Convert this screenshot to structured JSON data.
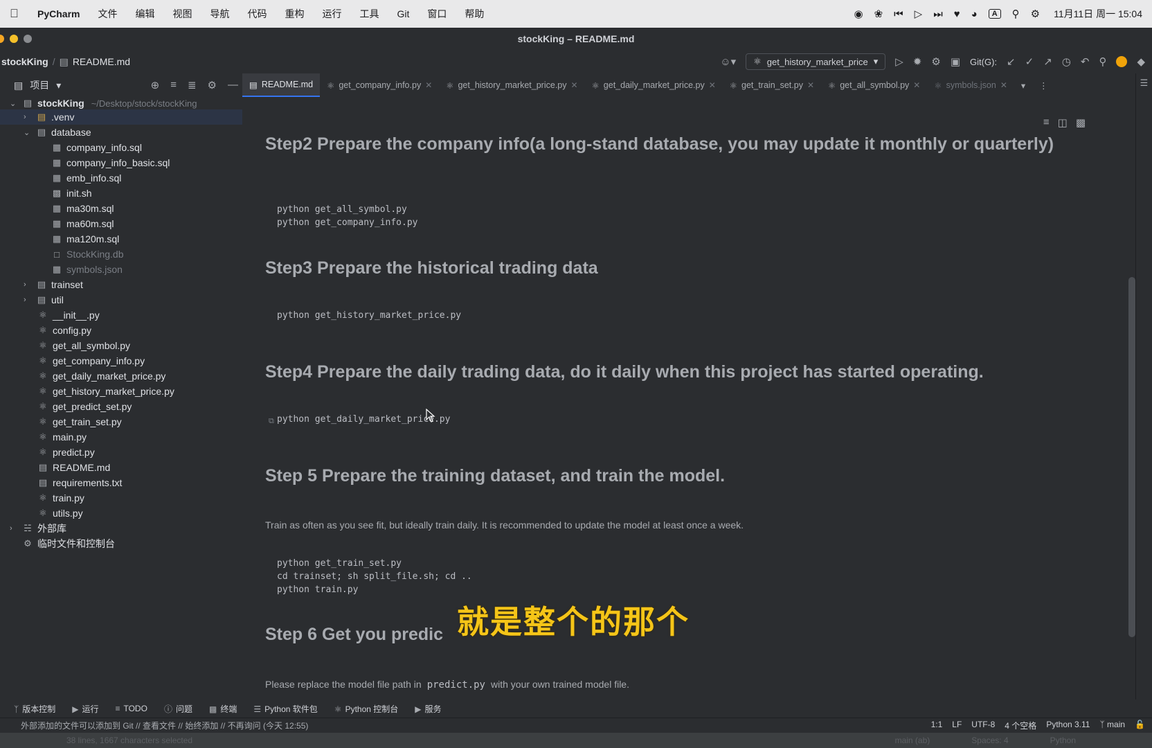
{
  "menubar": {
    "app": "PyCharm",
    "items": [
      "文件",
      "编辑",
      "视图",
      "导航",
      "代码",
      "重构",
      "运行",
      "工具",
      "Git",
      "窗口",
      "帮助"
    ],
    "clock": "11月11日 周一 15:04",
    "input_badge": "A"
  },
  "window": {
    "title": "stockKing – README.md"
  },
  "toolbar": {
    "project": "stockKing",
    "file": "README.md",
    "run_config": "get_history_market_price",
    "git_label": "Git(G):"
  },
  "project_pane": {
    "label": "项目"
  },
  "tabs": [
    {
      "label": "README.md",
      "active": true
    },
    {
      "label": "get_company_info.py"
    },
    {
      "label": "get_history_market_price.py"
    },
    {
      "label": "get_daily_market_price.py"
    },
    {
      "label": "get_train_set.py"
    },
    {
      "label": "get_all_symbol.py"
    },
    {
      "label": "symbols.json"
    }
  ],
  "tree": {
    "root": {
      "label": "stockKing",
      "path": "~/Desktop/stock/stockKing"
    },
    "venv": ".venv",
    "database": "database",
    "db_files": [
      "company_info.sql",
      "company_info_basic.sql",
      "emb_info.sql",
      "init.sh",
      "ma30m.sql",
      "ma60m.sql",
      "ma120m.sql",
      "StockKing.db",
      "symbols.json"
    ],
    "trainset": "trainset",
    "util": "util",
    "root_files": [
      "__init__.py",
      "config.py",
      "get_all_symbol.py",
      "get_company_info.py",
      "get_daily_market_price.py",
      "get_history_market_price.py",
      "get_predict_set.py",
      "get_train_set.py",
      "main.py",
      "predict.py",
      "README.md",
      "requirements.txt",
      "train.py",
      "utils.py"
    ],
    "external": "外部库",
    "scratches": "临时文件和控制台"
  },
  "readme": {
    "step2": {
      "title": "Step2 Prepare the company info(a long-stand database, you may update it monthly or quarterly)",
      "code": "python get_all_symbol.py\npython get_company_info.py"
    },
    "step3": {
      "title": "Step3 Prepare the historical trading data",
      "code": "python get_history_market_price.py"
    },
    "step4": {
      "title": "Step4 Prepare the daily trading data, do it daily when this project has started operating.",
      "code": "python get_daily_market_price.py"
    },
    "step5": {
      "title": "Step 5 Prepare the training dataset, and train the model.",
      "para": "Train as often as you see fit, but ideally train daily. It is recommended to update the model at least once a week.",
      "code": "python get_train_set.py\ncd trainset; sh split_file.sh; cd ..\npython train.py"
    },
    "step6": {
      "title": "Step 6 Get you predic",
      "para_before": "Please replace the model file path in",
      "para_code": "predict.py",
      "para_after": "with your own trained model file."
    }
  },
  "subtitle": "就是整个的那个",
  "bottom_tools": [
    "版本控制",
    "运行",
    "TODO",
    "问题",
    "终端",
    "Python 软件包",
    "Python 控制台",
    "服务"
  ],
  "status": {
    "message": "外部添加的文件可以添加到 Git // 查看文件 // 始终添加 // 不再询问 (今天 12:55)",
    "position": "1:1",
    "line_sep": "LF",
    "encoding": "UTF-8",
    "indent": "4 个空格",
    "interpreter": "Python 3.11",
    "branch": "main"
  },
  "status2": {
    "selection": "38 lines, 1667 characters selected",
    "branch": "main (ab)",
    "spaces": "Spaces: 4",
    "lang": "Python"
  }
}
